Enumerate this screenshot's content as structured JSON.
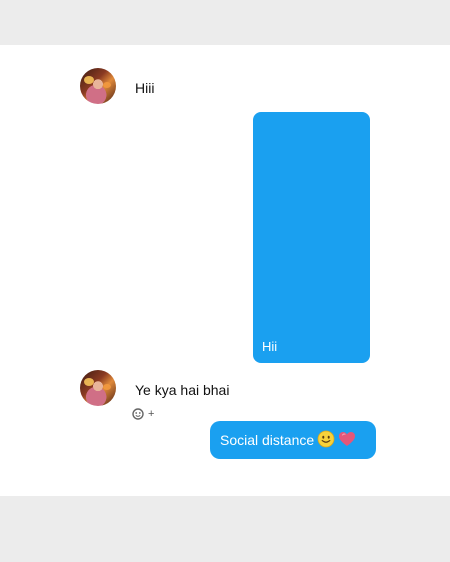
{
  "messages": {
    "first_received": "Hiii",
    "media_caption": "Hii",
    "second_received": "Ye kya hai bhai",
    "reaction_add": "+",
    "sent": "Social distance"
  },
  "icons": {
    "received_avatar": "profile-photo",
    "reaction": "add-reaction-icon",
    "emoji_1": "slightly-smiling-face",
    "emoji_2": "pink-heart"
  },
  "colors": {
    "bubble": "#1aa0f0",
    "background": "#ffffff",
    "frame": "#ececec"
  }
}
